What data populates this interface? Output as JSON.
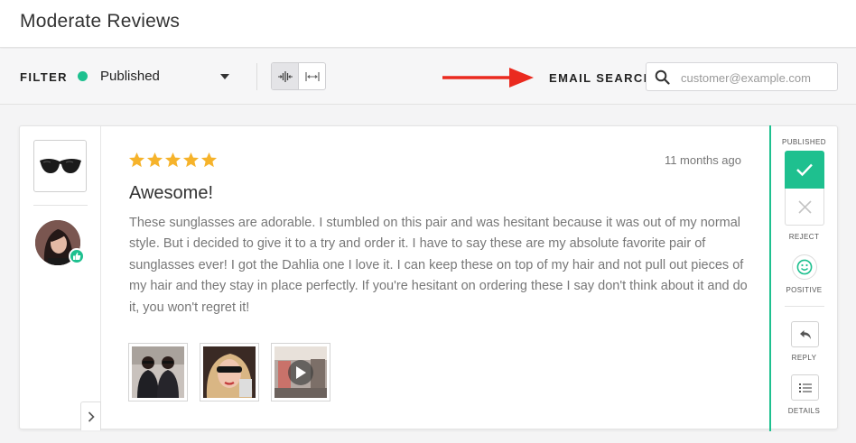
{
  "header": {
    "title": "Moderate Reviews"
  },
  "filter": {
    "label": "FILTER",
    "status_value": "Published",
    "status_color": "#1ec08f",
    "email_search_label": "EMAIL SEARCH",
    "email_placeholder": "customer@example.com",
    "email_value": ""
  },
  "review": {
    "rating": 5,
    "stars": [
      "★",
      "★",
      "★",
      "★",
      "★"
    ],
    "timestamp": "11 months ago",
    "title": "Awesome!",
    "body": "These sunglasses are adorable. I stumbled on this pair and was hesitant because it was out of my normal style. But i decided to give it to a try and order it. I have to say these are my absolute favorite pair of sunglasses ever! I got the Dahlia one I love it. I can keep these on top of my hair and not pull out pieces of my hair and they stay in place perfectly. If you're hesitant on ordering these I say don't think about it and do it, you won't regret it!",
    "media": [
      {
        "type": "photo",
        "icon": "photo-two-women-icon"
      },
      {
        "type": "photo",
        "icon": "photo-selfie-icon"
      },
      {
        "type": "video",
        "icon": "video-play-icon"
      }
    ]
  },
  "actions": {
    "published_label": "PUBLISHED",
    "reject_label": "REJECT",
    "positive_label": "POSITIVE",
    "reply_label": "REPLY",
    "details_label": "DETAILS",
    "accent_color": "#1ec08f",
    "star_color": "#f6b32b"
  }
}
